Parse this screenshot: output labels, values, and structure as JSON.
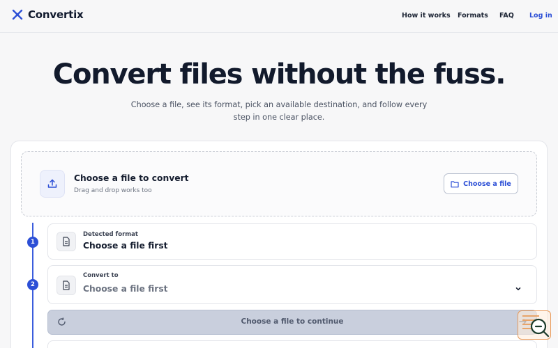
{
  "nav": {
    "brand": "Convertix",
    "links": [
      {
        "label": "How it works"
      },
      {
        "label": "Formats"
      },
      {
        "label": "FAQ"
      },
      {
        "label": "Log in"
      }
    ]
  },
  "hero": {
    "title": "Convert files without the fuss.",
    "subtitle": "Choose a file, see its format, pick an available destination, and follow every step in one clear place."
  },
  "upload": {
    "title": "Choose a file to convert",
    "hint": "Drag and drop works too",
    "button": "Choose a file",
    "icon": "upload-icon"
  },
  "steps": [
    {
      "number": "1",
      "label": "Detected format",
      "value": "Choose a file first",
      "icon": "document-icon"
    },
    {
      "number": "2",
      "label": "Convert to",
      "value": "Choose a file first",
      "icon": "document-icon",
      "control": "dropdown"
    }
  ],
  "continue_button": {
    "label": "Choose a file to continue",
    "enabled": false
  },
  "colors": {
    "accent": "#2c4fd6",
    "background": "#f7f7f8",
    "text": "#121a2c",
    "disabled_button": "#c9cfdd"
  }
}
